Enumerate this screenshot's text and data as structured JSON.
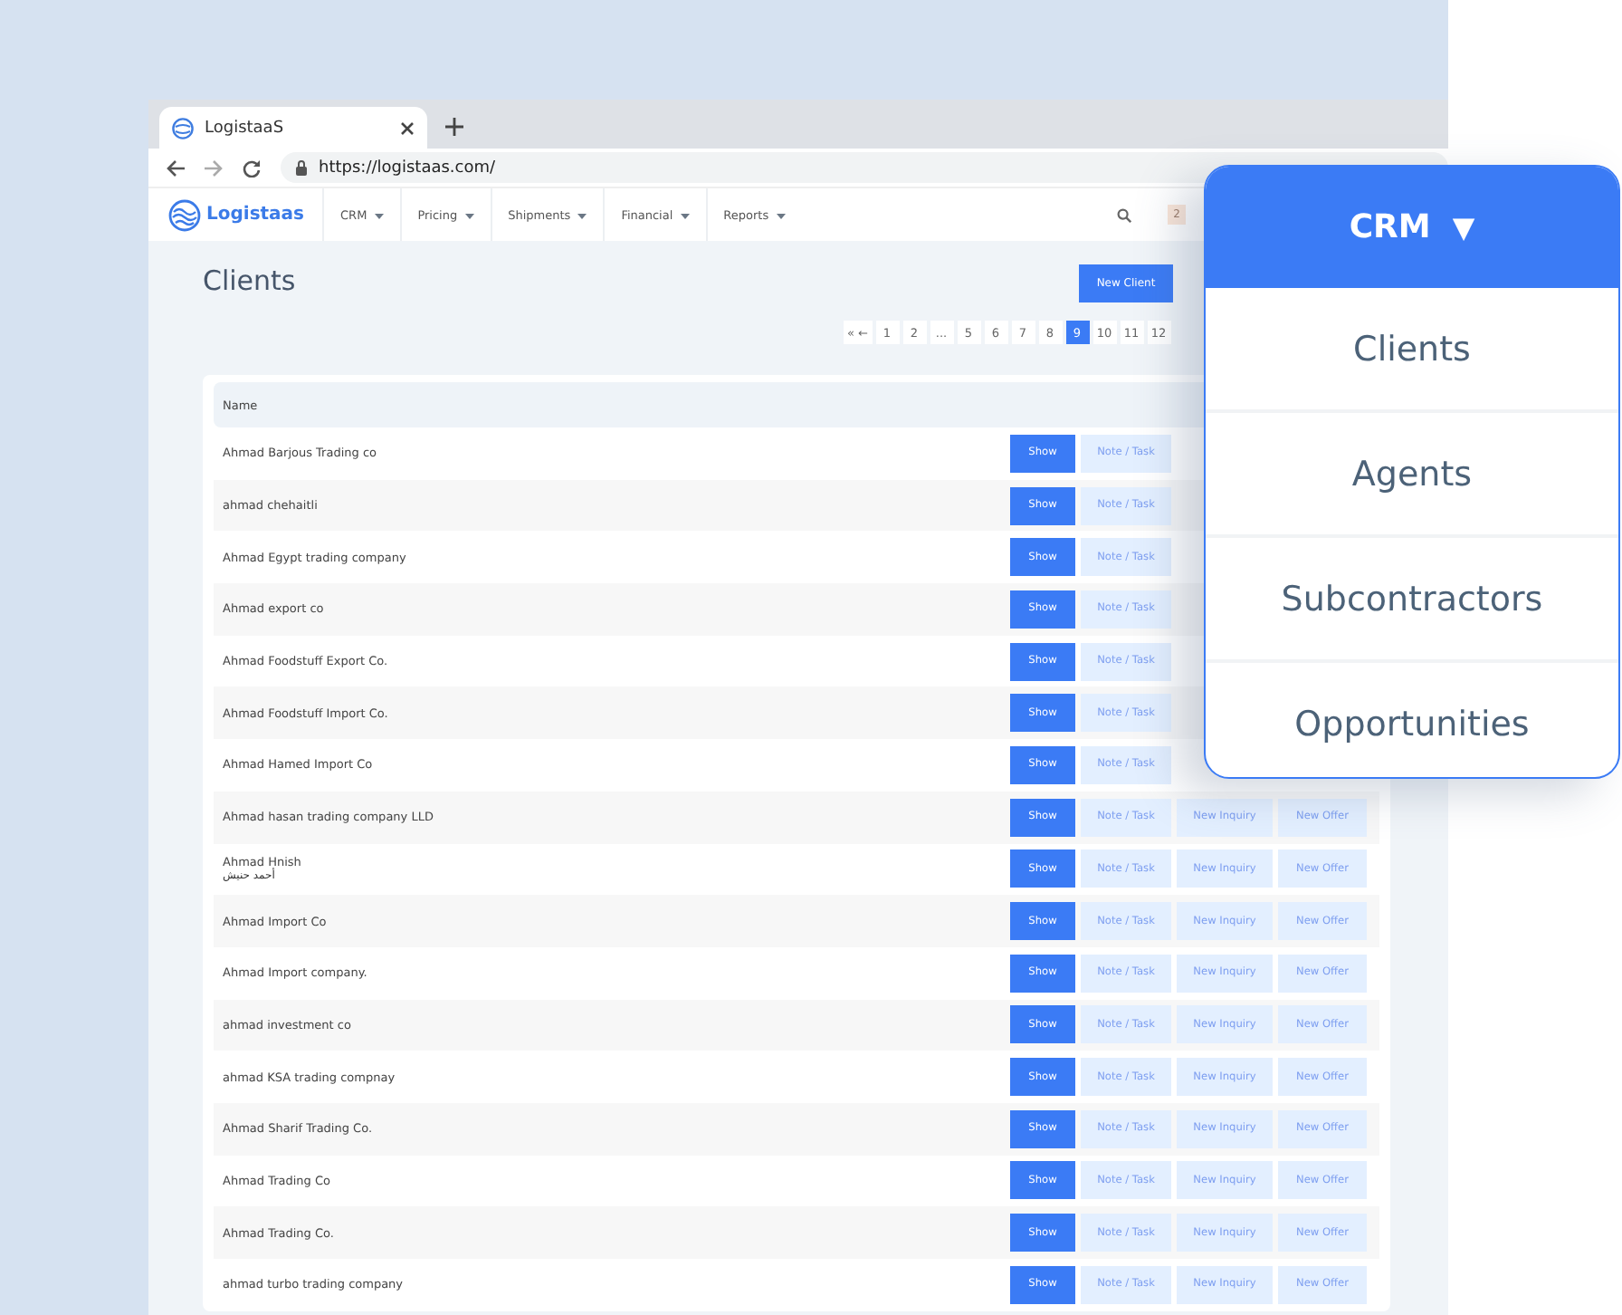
{
  "browser": {
    "tab_title": "LogistaaS",
    "url": "https://logistaas.com/"
  },
  "app_nav": {
    "brand": "Logistaas",
    "menus": [
      {
        "label": "CRM"
      },
      {
        "label": "Pricing"
      },
      {
        "label": "Shipments"
      },
      {
        "label": "Financial"
      },
      {
        "label": "Reports"
      }
    ],
    "badge": "2"
  },
  "page": {
    "title": "Clients",
    "new_button": "New Client"
  },
  "pagination": [
    {
      "label": "« ←",
      "selected": false
    },
    {
      "label": "1",
      "selected": false
    },
    {
      "label": "2",
      "selected": false
    },
    {
      "label": "...",
      "selected": false
    },
    {
      "label": "5",
      "selected": false
    },
    {
      "label": "6",
      "selected": false
    },
    {
      "label": "7",
      "selected": false
    },
    {
      "label": "8",
      "selected": false
    },
    {
      "label": "9",
      "selected": true
    },
    {
      "label": "10",
      "selected": false
    },
    {
      "label": "11",
      "selected": false
    },
    {
      "label": "12",
      "selected": false
    }
  ],
  "table": {
    "columns": [
      "Name"
    ],
    "rows": [
      {
        "name": "Ahmad Barjous Trading co",
        "actions": [
          "Show",
          "Note / Task"
        ]
      },
      {
        "name": "ahmad chehaitli",
        "actions": [
          "Show",
          "Note / Task"
        ]
      },
      {
        "name": "Ahmad Egypt trading company",
        "actions": [
          "Show",
          "Note / Task"
        ]
      },
      {
        "name": "Ahmad export co",
        "actions": [
          "Show",
          "Note / Task"
        ]
      },
      {
        "name": "Ahmad Foodstuff Export Co.",
        "actions": [
          "Show",
          "Note / Task"
        ]
      },
      {
        "name": "Ahmad Foodstuff Import Co.",
        "actions": [
          "Show",
          "Note / Task"
        ]
      },
      {
        "name": "Ahmad Hamed Import Co",
        "actions": [
          "Show",
          "Note / Task"
        ]
      },
      {
        "name": "Ahmad hasan trading company LLD",
        "actions": [
          "Show",
          "Note / Task",
          "New Inquiry",
          "New Offer"
        ]
      },
      {
        "name": "Ahmad Hnish",
        "subname": "أحمد حنيش",
        "actions": [
          "Show",
          "Note / Task",
          "New Inquiry",
          "New Offer"
        ]
      },
      {
        "name": "Ahmad Import Co",
        "actions": [
          "Show",
          "Note / Task",
          "New Inquiry",
          "New Offer"
        ]
      },
      {
        "name": "Ahmad Import company.",
        "actions": [
          "Show",
          "Note / Task",
          "New Inquiry",
          "New Offer"
        ]
      },
      {
        "name": "ahmad investment co",
        "actions": [
          "Show",
          "Note / Task",
          "New Inquiry",
          "New Offer"
        ]
      },
      {
        "name": "ahmad KSA trading compnay",
        "actions": [
          "Show",
          "Note / Task",
          "New Inquiry",
          "New Offer"
        ]
      },
      {
        "name": "Ahmad Sharif Trading Co.",
        "actions": [
          "Show",
          "Note / Task",
          "New Inquiry",
          "New Offer"
        ]
      },
      {
        "name": "Ahmad Trading Co",
        "actions": [
          "Show",
          "Note / Task",
          "New Inquiry",
          "New Offer"
        ]
      },
      {
        "name": "Ahmad Trading Co.",
        "actions": [
          "Show",
          "Note / Task",
          "New Inquiry",
          "New Offer"
        ]
      },
      {
        "name": "ahmad turbo trading company",
        "actions": [
          "Show",
          "Note / Task",
          "New Inquiry",
          "New Offer"
        ]
      }
    ]
  },
  "crm_dropdown": {
    "title": "CRM",
    "caret": "▼",
    "items": [
      "Clients",
      "Agents",
      "Subcontractors",
      "Opportunities"
    ]
  }
}
